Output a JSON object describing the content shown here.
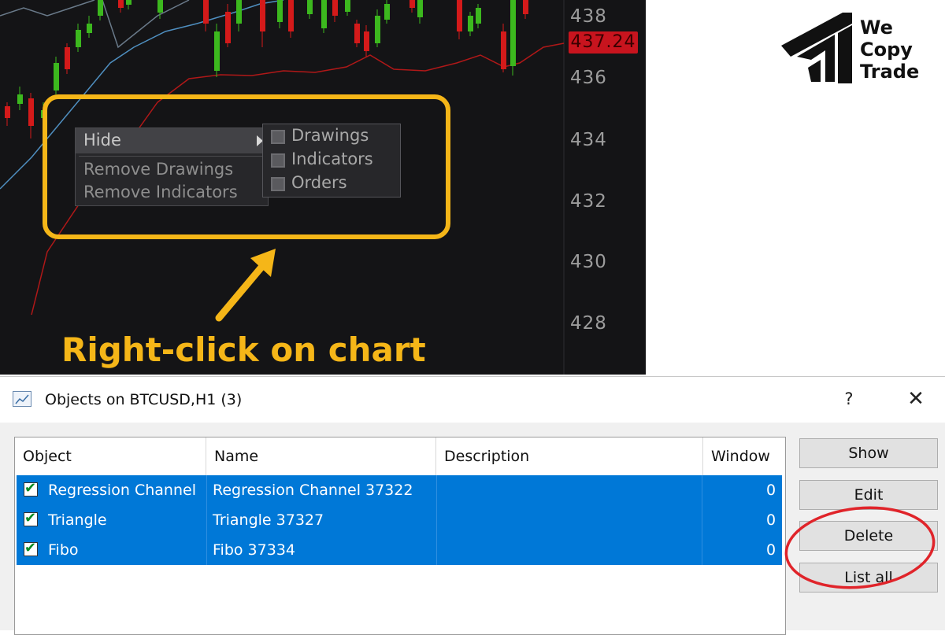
{
  "chart": {
    "price_axis": [
      "438",
      "436",
      "434",
      "432",
      "430",
      "428"
    ],
    "current_price": "437.24",
    "colors": {
      "up": "#3cb81e",
      "down": "#d41a1a",
      "bollinger_mid": "#5a7a9a",
      "bollinger_low": "#b01818",
      "highlight": "#f5b618"
    }
  },
  "context_menu": {
    "hide_label": "Hide",
    "remove_drawings": "Remove Drawings",
    "remove_indicators": "Remove Indicators",
    "submenu": [
      {
        "label": "Drawings"
      },
      {
        "label": "Indicators"
      },
      {
        "label": "Orders"
      }
    ]
  },
  "caption": "Right-click on chart",
  "logo": {
    "line1": "We",
    "line2": "Copy",
    "line3": "Trade"
  },
  "dialog": {
    "title": "Objects on BTCUSD,H1 (3)",
    "help": "?",
    "close": "✕",
    "columns": [
      "Object",
      "Name",
      "Description",
      "Window"
    ],
    "rows": [
      {
        "object": "Regression Channel",
        "name": "Regression Channel 37322",
        "description": "",
        "window": "0"
      },
      {
        "object": "Triangle",
        "name": "Triangle 37327",
        "description": "",
        "window": "0"
      },
      {
        "object": "Fibo",
        "name": "Fibo 37334",
        "description": "",
        "window": "0"
      }
    ],
    "buttons": {
      "show": "Show",
      "edit": "Edit",
      "delete": "Delete",
      "list_all": "List all"
    }
  }
}
